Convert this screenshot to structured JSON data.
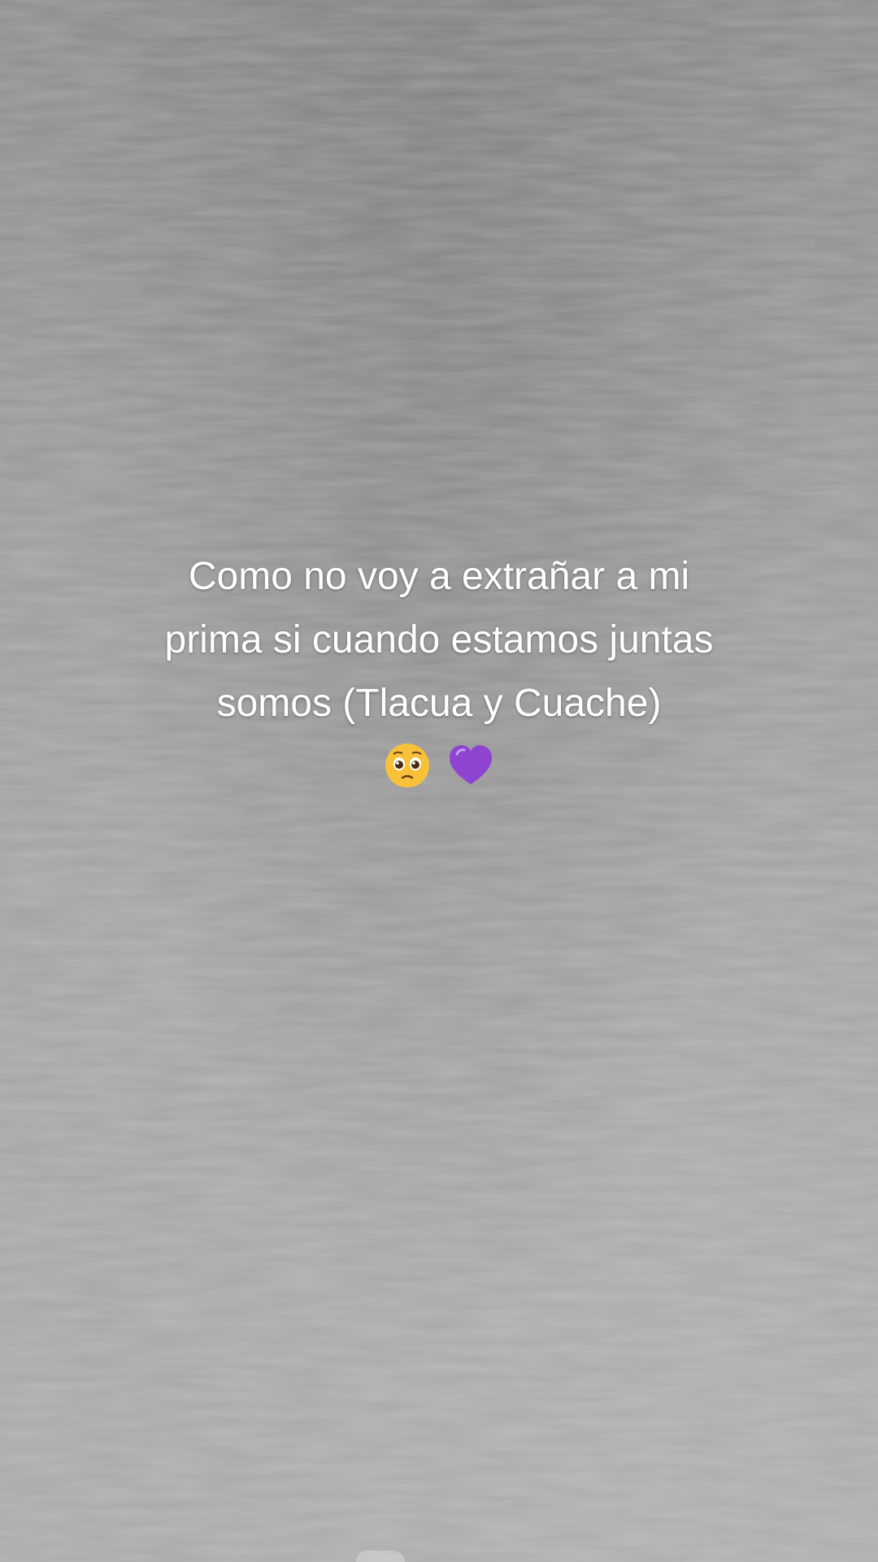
{
  "caption": {
    "lines": [
      "Como no voy a extrañar a mi",
      "prima si cuando estamos juntas",
      "somos (Tlacua y Cuache)"
    ]
  },
  "emojis": [
    {
      "name": "pleading-face-icon",
      "glyph": "🥺"
    },
    {
      "name": "purple-heart-icon",
      "glyph": "💜"
    }
  ],
  "colors": {
    "text": "#ffffff",
    "background": "#9e9e9e",
    "heart": "#8e44d1",
    "face": "#f7c23a"
  }
}
